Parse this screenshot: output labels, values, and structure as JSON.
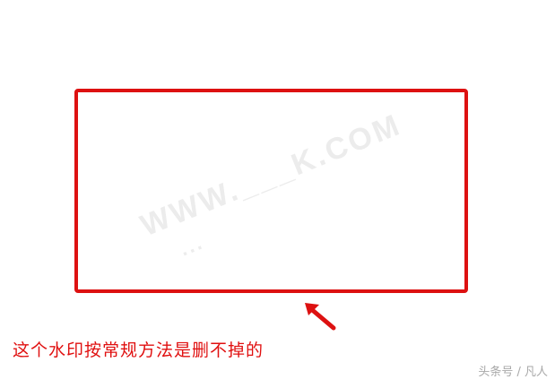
{
  "colors": {
    "accent": "#dd1111",
    "caption": "#e01010",
    "watermark": "#ececec",
    "source_mark": "#a8a8a8"
  },
  "watermark": {
    "line1": "WWW.___K.COM",
    "line2": "..."
  },
  "caption": "这个水印按常规方法是删不掉的",
  "source_mark": "头条号 / 凡人",
  "icons": {
    "arrow": "arrow-up-left-icon"
  }
}
